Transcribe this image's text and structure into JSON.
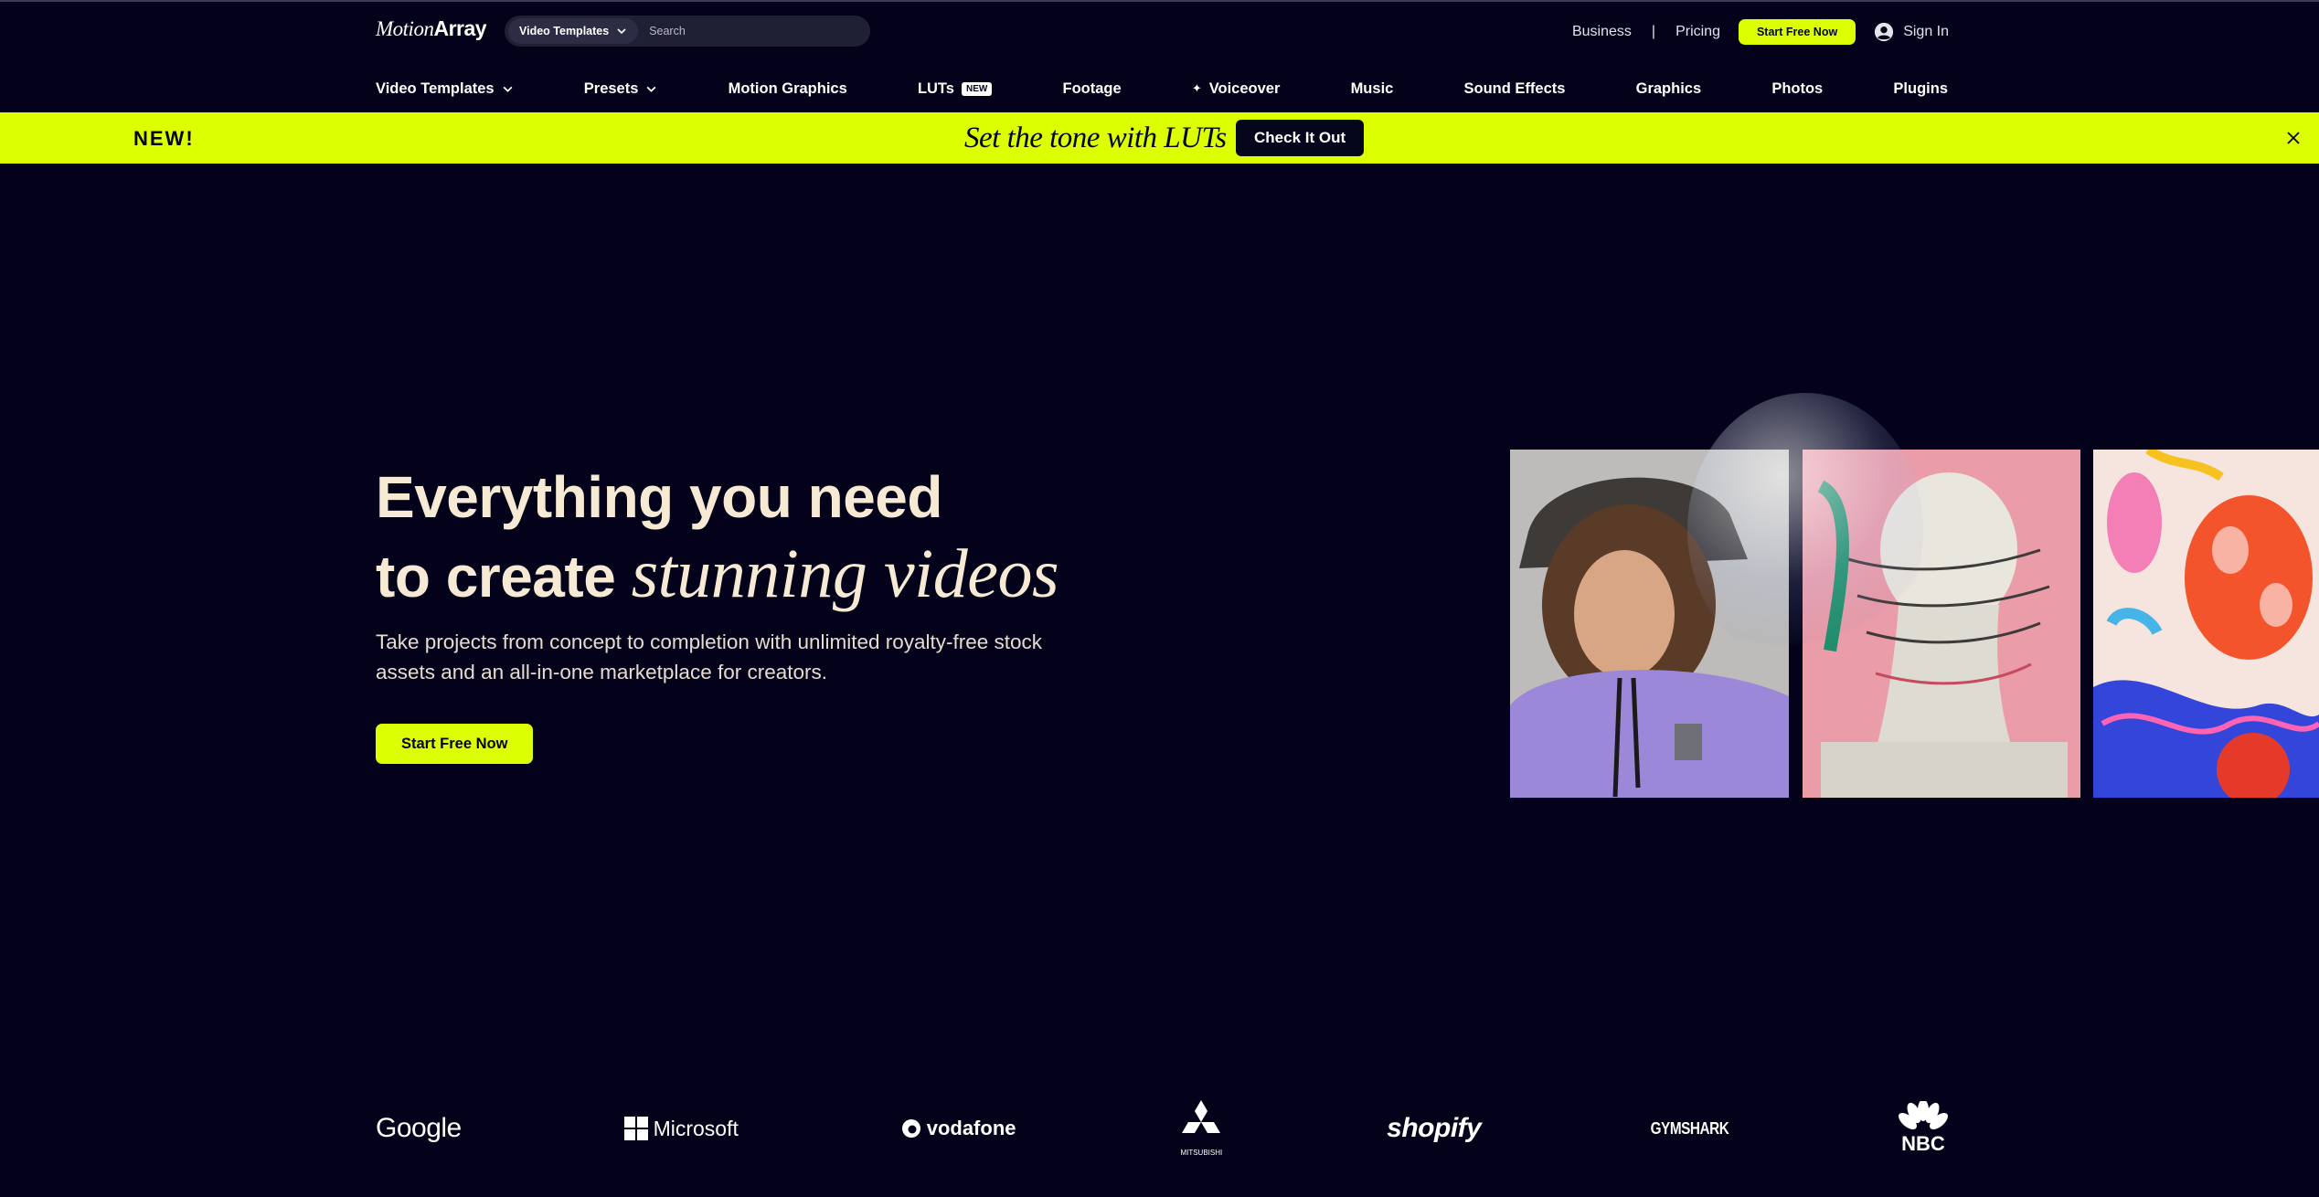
{
  "header": {
    "logo_part1": "Motion",
    "logo_part2": "Array",
    "search_category": "Video Templates",
    "search_placeholder": "Search",
    "business": "Business",
    "separator": "|",
    "pricing": "Pricing",
    "start_free": "Start Free Now",
    "sign_in": "Sign In"
  },
  "nav": {
    "items": [
      {
        "label": "Video Templates",
        "has_dropdown": true
      },
      {
        "label": "Presets",
        "has_dropdown": true
      },
      {
        "label": "Motion Graphics"
      },
      {
        "label": "LUTs",
        "badge": "NEW"
      },
      {
        "label": "Footage"
      },
      {
        "label": "Voiceover",
        "icon": "sparkle-icon"
      },
      {
        "label": "Music"
      },
      {
        "label": "Sound Effects"
      },
      {
        "label": "Graphics"
      },
      {
        "label": "Photos"
      },
      {
        "label": "Plugins"
      }
    ]
  },
  "promo": {
    "new_label": "NEW!",
    "tagline": "Set the tone with LUTs",
    "cta": "Check It Out"
  },
  "hero": {
    "title_line1": "Everything you need",
    "title_line2_plain": "to create ",
    "title_line2_accent": "stunning videos",
    "subtitle": "Take projects from concept to completion with unlimited royalty-free stock assets and an all-in-one marketplace for creators.",
    "cta": "Start Free Now"
  },
  "logos": {
    "google": "Google",
    "microsoft": "Microsoft",
    "vodafone": "vodafone",
    "mitsubishi": "MITSUBISHI",
    "shopify": "shopify",
    "gymshark": "GYMSHARK",
    "nbc": "NBC"
  },
  "colors": {
    "background": "#03021a",
    "accent_lime": "#dcff02",
    "headline": "#f7ead4"
  }
}
